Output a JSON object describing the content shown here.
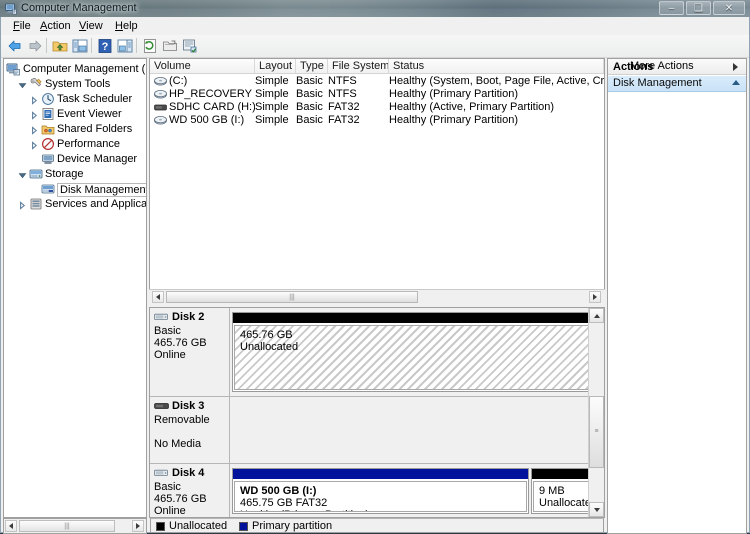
{
  "window": {
    "title": "Computer Management",
    "icon": "computer-management-icon",
    "controls": {
      "minimize": "–",
      "maximize": "❑",
      "close": "✕"
    }
  },
  "menu": [
    {
      "label": "File",
      "name": "menu-file"
    },
    {
      "label": "Action",
      "name": "menu-action"
    },
    {
      "label": "View",
      "name": "menu-view"
    },
    {
      "label": "Help",
      "name": "menu-help"
    }
  ],
  "toolbar": [
    {
      "name": "back-icon"
    },
    {
      "name": "forward-icon"
    },
    {
      "name": "up-folder-icon"
    },
    {
      "name": "show-hide-console-tree-icon"
    },
    {
      "name": "help-icon"
    },
    {
      "name": "show-hide-action-pane-icon"
    },
    {
      "name": "refresh-icon"
    },
    {
      "name": "properties-icon"
    },
    {
      "name": "rescan-disks-icon"
    }
  ],
  "tree": {
    "root": {
      "label": "Computer Management (Local",
      "icon": "computer-icon"
    },
    "items": [
      {
        "label": "System Tools",
        "icon": "system-tools-icon",
        "indent": 1,
        "expander": "expanded"
      },
      {
        "label": "Task Scheduler",
        "icon": "task-scheduler-icon",
        "indent": 2,
        "expander": "collapsed"
      },
      {
        "label": "Event Viewer",
        "icon": "event-viewer-icon",
        "indent": 2,
        "expander": "collapsed"
      },
      {
        "label": "Shared Folders",
        "icon": "shared-folders-icon",
        "indent": 2,
        "expander": "collapsed"
      },
      {
        "label": "Performance",
        "icon": "performance-icon",
        "indent": 2,
        "expander": "collapsed"
      },
      {
        "label": "Device Manager",
        "icon": "device-manager-icon",
        "indent": 2,
        "expander": "none"
      },
      {
        "label": "Storage",
        "icon": "storage-icon",
        "indent": 1,
        "expander": "expanded"
      },
      {
        "label": "Disk Management",
        "icon": "disk-management-icon",
        "indent": 2,
        "expander": "none",
        "selected": true
      },
      {
        "label": "Services and Applications",
        "icon": "services-icon",
        "indent": 1,
        "expander": "collapsed"
      }
    ]
  },
  "volume_list": {
    "columns": [
      "Volume",
      "Layout",
      "Type",
      "File System",
      "Status"
    ],
    "rows": [
      {
        "volume": "(C:)",
        "icon": "volume-icon",
        "layout": "Simple",
        "type": "Basic",
        "filesystem": "NTFS",
        "status": "Healthy (System, Boot, Page File, Active, Crash Dump, Prir"
      },
      {
        "volume": "HP_RECOVERY (D:)",
        "icon": "volume-icon",
        "layout": "Simple",
        "type": "Basic",
        "filesystem": "NTFS",
        "status": "Healthy (Primary Partition)"
      },
      {
        "volume": "SDHC CARD (H:)",
        "icon": "removable-volume-icon",
        "layout": "Simple",
        "type": "Basic",
        "filesystem": "FAT32",
        "status": "Healthy (Active, Primary Partition)"
      },
      {
        "volume": "WD 500 GB (I:)",
        "icon": "volume-icon",
        "layout": "Simple",
        "type": "Basic",
        "filesystem": "FAT32",
        "status": "Healthy (Primary Partition)"
      }
    ]
  },
  "disks": [
    {
      "name": "Disk 2",
      "icon": "disk-icon",
      "line1": "Basic",
      "line2": "465.76 GB",
      "line3": "Online",
      "partitions": [
        {
          "bar_color": "#000000",
          "fill": "hatch",
          "label1": "465.76 GB",
          "label2": "Unallocated",
          "label3": ""
        }
      ]
    },
    {
      "name": "Disk 3",
      "icon": "removable-disk-icon",
      "line1": "Removable",
      "line2": "",
      "line3": "No Media",
      "partitions": []
    },
    {
      "name": "Disk 4",
      "icon": "disk-icon",
      "line1": "Basic",
      "line2": "465.76 GB",
      "line3": "Online",
      "partitions": [
        {
          "bar_color": "#00129b",
          "fill": "solid",
          "label1": "WD 500 GB  (I:)",
          "label2": "465.75 GB FAT32",
          "label3": "Healthy (Primary Partition)"
        },
        {
          "bar_color": "#000000",
          "fill": "solid",
          "label1": "9 MB",
          "label2": "Unallocate",
          "label3": ""
        }
      ]
    }
  ],
  "legend": [
    {
      "label": "Unallocated",
      "color": "#000000"
    },
    {
      "label": "Primary partition",
      "color": "#00129b"
    }
  ],
  "actions": {
    "title": "Actions",
    "group": "Disk Management",
    "items": [
      {
        "label": "More Actions",
        "submenu": true
      }
    ]
  },
  "colors": {
    "accent_blue": "#00129b",
    "unallocated": "#000000",
    "selection_blue": "#c9e2f7"
  }
}
